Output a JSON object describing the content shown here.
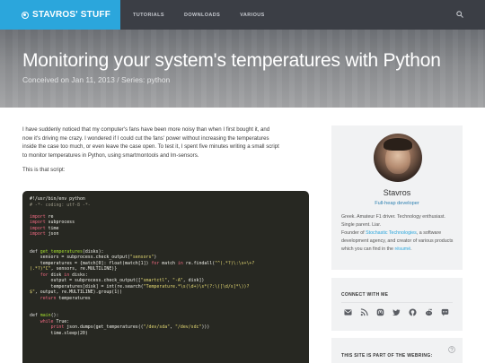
{
  "header": {
    "brand": "STAVROS' STUFF",
    "nav": [
      "TUTORIALS",
      "DOWNLOADS",
      "VARIOUS"
    ]
  },
  "hero": {
    "title": "Monitoring your system's temperatures with Python",
    "meta": "Conceived on Jan 11, 2013 / Series: python"
  },
  "article": {
    "intro_lines": [
      "I have suddenly noticed that my computer's fans have been more noisy than when I first bought it, and",
      "now it's driving me crazy. I wondered if I could cut the fans' power without increasing the temperatures",
      "inside the case too much, or even leave the case open. To test it, I spent five minutes writing a small script",
      "to monitor temperatures in Python, using smartmontools and lm-sensors."
    ],
    "script_intro": "This is that script:",
    "code": [
      [
        [
          "c-txt",
          "#!/usr/bin/env python"
        ]
      ],
      [
        [
          "c-com",
          "# -*- coding: utf-8 -*-"
        ]
      ],
      [],
      [
        [
          "c-kw",
          "import"
        ],
        [
          "c-txt",
          " re"
        ]
      ],
      [
        [
          "c-kw",
          "import"
        ],
        [
          "c-txt",
          " subprocess"
        ]
      ],
      [
        [
          "c-kw",
          "import"
        ],
        [
          "c-txt",
          " time"
        ]
      ],
      [
        [
          "c-kw",
          "import"
        ],
        [
          "c-txt",
          " json"
        ]
      ],
      [],
      [],
      [
        [
          "c-def",
          "def"
        ],
        [
          "c-fn",
          " get_temperatures"
        ],
        [
          "c-txt",
          "(disks):"
        ]
      ],
      [
        [
          "c-txt",
          "    sensors = subprocess.check_output("
        ],
        [
          "c-str",
          "\"sensors\""
        ],
        [
          "c-txt",
          ")"
        ]
      ],
      [
        [
          "c-txt",
          "    temperatures = {match[0]: float(match[1]) "
        ],
        [
          "c-kw",
          "for"
        ],
        [
          "c-txt",
          " match "
        ],
        [
          "c-kw",
          "in"
        ],
        [
          "c-txt",
          " re.findall("
        ],
        [
          "c-str",
          "\"^(.*?)\\:\\s+\\+?"
        ]
      ],
      [
        [
          "c-str",
          "(.*?)°C\""
        ],
        [
          "c-txt",
          ", sensors, re.MULTILINE)}"
        ]
      ],
      [
        [
          "c-txt",
          "    "
        ],
        [
          "c-kw",
          "for"
        ],
        [
          "c-txt",
          " disk "
        ],
        [
          "c-kw",
          "in"
        ],
        [
          "c-txt",
          " disks:"
        ]
      ],
      [
        [
          "c-txt",
          "        output = subprocess.check_output(["
        ],
        [
          "c-str",
          "\"smartctl\""
        ],
        [
          "c-txt",
          ", "
        ],
        [
          "c-str",
          "\"-A\""
        ],
        [
          "c-txt",
          ", disk])"
        ]
      ],
      [
        [
          "c-txt",
          "        temperatures[disk] = int(re.search("
        ],
        [
          "c-str",
          "\"Temperature.*\\s(\\d+)\\s*(?:\\([\\d/s]*\\))?"
        ]
      ],
      [
        [
          "c-str",
          "$\""
        ],
        [
          "c-txt",
          ", output, re.MULTILINE).group(1))"
        ]
      ],
      [
        [
          "c-txt",
          "    "
        ],
        [
          "c-kw",
          "return"
        ],
        [
          "c-txt",
          " temperatures"
        ]
      ],
      [],
      [],
      [
        [
          "c-def",
          "def"
        ],
        [
          "c-fn",
          " main"
        ],
        [
          "c-txt",
          "():"
        ]
      ],
      [
        [
          "c-txt",
          "    "
        ],
        [
          "c-kw",
          "while"
        ],
        [
          "c-txt",
          " True:"
        ]
      ],
      [
        [
          "c-txt",
          "        "
        ],
        [
          "c-kw",
          "print"
        ],
        [
          "c-txt",
          " json.dumps(get_temperatures(("
        ],
        [
          "c-str",
          "\"/dev/sda\""
        ],
        [
          "c-txt",
          ", "
        ],
        [
          "c-str",
          "\"/dev/sdc\""
        ],
        [
          "c-txt",
          ")))"
        ]
      ],
      [
        [
          "c-txt",
          "        time.sleep(20)"
        ]
      ]
    ]
  },
  "sidebar": {
    "profile": {
      "name": "Stavros",
      "role": "Full-heap developer",
      "bio_1": "Greek. Amateur F1 driver. Technology enthusiast. Single parent. Liar.",
      "bio_2_pre": "Founder of ",
      "bio_2_link": "Stochastic Technologies",
      "bio_2_post": ", a software development agency, and creator of various products which you can find in the ",
      "bio_2_link2": "résumé",
      "bio_2_end": "."
    },
    "connect": {
      "heading": "CONNECT WITH ME",
      "icons": [
        "email-icon",
        "rss-icon",
        "mastodon-icon",
        "twitter-icon",
        "github-icon",
        "reddit-icon",
        "messenger-icon"
      ]
    },
    "webring": {
      "heading": "THIS SITE IS PART OF THE WEBRING:"
    }
  },
  "colors": {
    "brand_blue": "#2ba6dc",
    "nav_bg": "#3b3e45",
    "code_bg": "#272822"
  }
}
